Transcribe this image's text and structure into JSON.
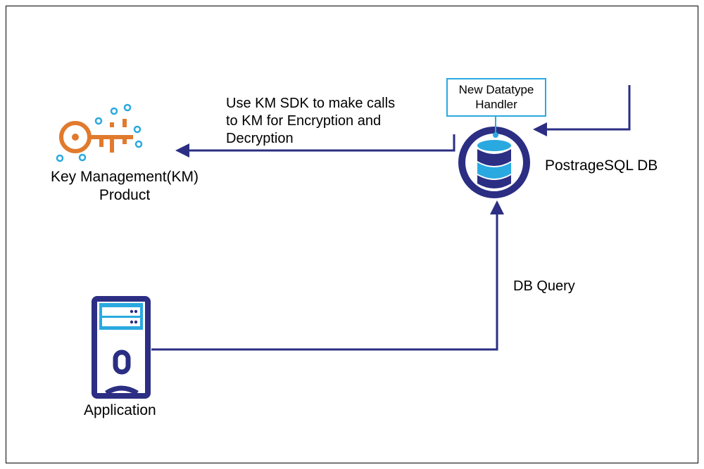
{
  "diagram": {
    "nodes": {
      "km": {
        "label": "Key Management(KM)\nProduct"
      },
      "app": {
        "label": "Application"
      },
      "db": {
        "label": "PostrageSQL DB"
      }
    },
    "callout": {
      "datatype": "New Datatype\nHandler"
    },
    "edges": {
      "sdk": {
        "label": "Use KM SDK to make calls\nto KM for Encryption and\nDecryption"
      },
      "query": {
        "label": "DB Query"
      }
    },
    "colors": {
      "darkblue": "#2B2E83",
      "cyan": "#2AA9E0",
      "orange": "#E17A2D"
    }
  }
}
